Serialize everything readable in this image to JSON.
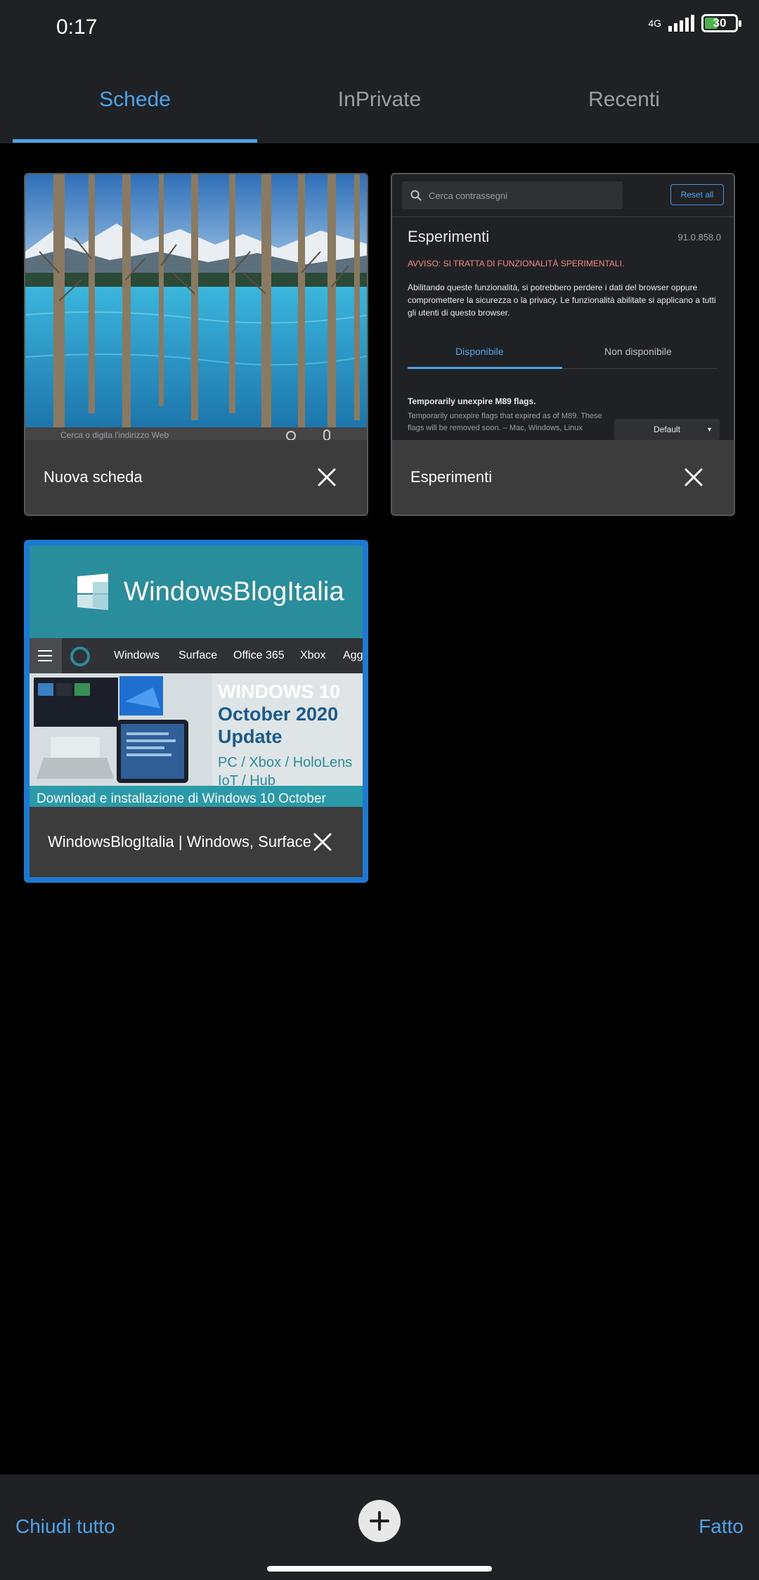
{
  "status_bar": {
    "time": "0:17",
    "network": "4G",
    "battery": "30",
    "icons": [
      "signal-icon",
      "battery-icon"
    ]
  },
  "tabs": [
    {
      "label": "Schede",
      "active": true
    },
    {
      "label": "InPrivate",
      "active": false
    },
    {
      "label": "Recenti",
      "active": false
    }
  ],
  "cards": [
    {
      "title": "Nuova scheda",
      "thumbnail": "lake-landscape-new-tab",
      "search_placeholder": "Cerca o digita l'indirizzo Web"
    },
    {
      "title": "Esperimenti",
      "experiments": {
        "search_placeholder": "Cerca contrassegni",
        "reset_label": "Reset all",
        "heading": "Esperimenti",
        "version": "91.0.858.0",
        "warning": "AVVISO: SI TRATTA DI FUNZIONALITÀ SPERIMENTALI.",
        "description": "Abilitando queste funzionalità, si potrebbero perdere i dati del browser oppure compromettere la sicurezza o la privacy. Le funzionalità abilitate si applicano a tutti gli utenti di questo browser.",
        "tab_available": "Disponibile",
        "tab_unavailable": "Non disponibile",
        "flag_title": "Temporarily unexpire M89 flags.",
        "flag_desc": "Temporarily unexpire flags that expired as of M89. These flags will be removed soon. – Mac, Windows, Linux",
        "select_value": "Default"
      }
    },
    {
      "title": "WindowsBlogItalia | Windows, Surface",
      "selected": true,
      "site": {
        "name": "WindowsBlogItalia",
        "nav": [
          "Windows",
          "Surface",
          "Office 365",
          "Xbox",
          "Agg"
        ],
        "hero_title_1": "WINDOWS 10",
        "hero_title_2": "October 2020",
        "hero_title_3": "Update",
        "hero_sub_1": "PC / Xbox / HoloLens",
        "hero_sub_2": "IoT / Hub",
        "caption": "Download e installazione di Windows 10 October"
      }
    }
  ],
  "bottom_bar": {
    "close_all": "Chiudi tutto",
    "done": "Fatto",
    "add_icon": "plus-icon"
  },
  "colors": {
    "accent": "#4da3e8",
    "selected_border": "#1e7ad1",
    "bar_background": "#202124",
    "card_footer": "#3c3c3c"
  }
}
